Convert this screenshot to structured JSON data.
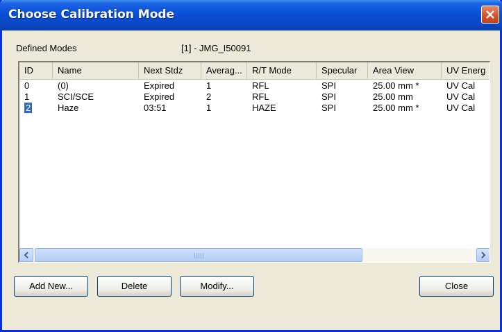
{
  "window": {
    "title": "Choose Calibration Mode",
    "close_icon": "close-x-icon"
  },
  "defined_modes_label": "Defined Modes",
  "instrument_label": "[1] - JMG_I50091",
  "table": {
    "columns": [
      "ID",
      "Name",
      "Next Stdz",
      "Averag...",
      "R/T Mode",
      "Specular",
      "Area View",
      "UV Energ"
    ],
    "rows": [
      [
        "0",
        "(0)",
        "Expired",
        "1",
        "RFL",
        "SPI",
        "25.00 mm *",
        "UV Cal"
      ],
      [
        "1",
        "SCI/SCE",
        "Expired",
        "2",
        "RFL",
        "SPI",
        "25.00 mm",
        "UV Cal"
      ],
      [
        "2",
        "Haze",
        "03:51",
        "1",
        "HAZE",
        "SPI",
        "25.00 mm *",
        "UV Cal"
      ]
    ],
    "selected_row": 2
  },
  "buttons": {
    "add_new": "Add New...",
    "delete": "Delete",
    "modify": "Modify...",
    "close": "Close"
  },
  "colors": {
    "titlebar": "#0a4fd6",
    "selection": "#316ac5",
    "close_button": "#d5532c"
  }
}
